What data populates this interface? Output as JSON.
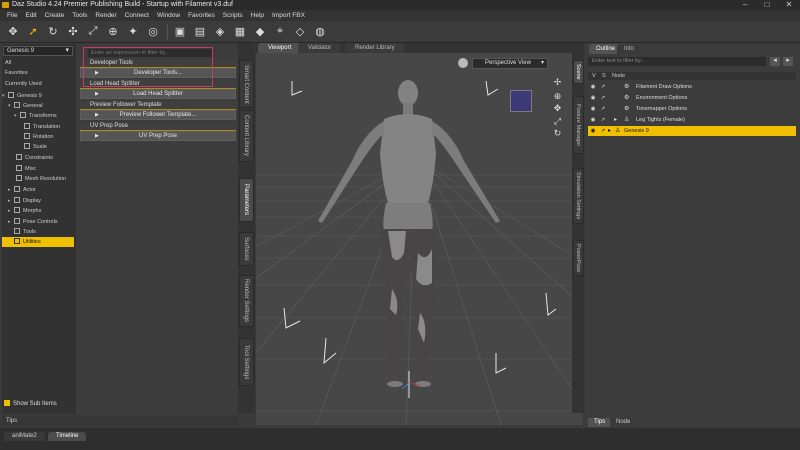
{
  "title": "Daz Studio 4.24 Premier Publishing Build - Startup with Filament v3.duf",
  "menu": [
    "File",
    "Edit",
    "Create",
    "Tools",
    "Render",
    "Connect",
    "Window",
    "Favorites",
    "Scripts",
    "Help",
    "Import FBX"
  ],
  "toolbar_icons": [
    "universal-tool",
    "pointer-tool",
    "rotate-tool",
    "translate-tool",
    "scale-tool",
    "node-tool",
    "pose-tool",
    "camera-tool",
    "render-tool",
    "render-settings-tool",
    "spot-render-tool",
    "preview-tool",
    "morph-tool",
    "joint-tool",
    "geometry-tool",
    "surface-tool"
  ],
  "left": {
    "scope": "Genesis 9",
    "filter_placeholder": "Enter an expression to filter by...",
    "tree": [
      {
        "label": "All",
        "indent": 0
      },
      {
        "label": "Favorites",
        "indent": 0
      },
      {
        "label": "Currently Used",
        "indent": 0
      },
      {
        "label": "Genesis 9",
        "indent": 0
      },
      {
        "label": "General",
        "indent": 1
      },
      {
        "label": "Transforms",
        "indent": 2
      },
      {
        "label": "Translation",
        "indent": 3
      },
      {
        "label": "Rotation",
        "indent": 3
      },
      {
        "label": "Scale",
        "indent": 3
      },
      {
        "label": "Constraints",
        "indent": 2
      },
      {
        "label": "Misc",
        "indent": 2
      },
      {
        "label": "Mesh Resolution",
        "indent": 2
      },
      {
        "label": "Actor",
        "indent": 1
      },
      {
        "label": "Display",
        "indent": 1
      },
      {
        "label": "Morphs",
        "indent": 1
      },
      {
        "label": "Pose Controls",
        "indent": 1
      },
      {
        "label": "Tools",
        "indent": 1
      },
      {
        "label": "Utilities",
        "indent": 1
      }
    ],
    "selected_tree": "Utilities",
    "show_sub_items": "Show Sub Items",
    "groups": [
      {
        "label": "Developer Tools",
        "button": "Developer Tools..."
      },
      {
        "label": "Load Head Splitter",
        "button": "Load Head Splitter"
      },
      {
        "label": "Preview Follower Template",
        "button": "Preview Follower Template..."
      },
      {
        "label": "UV Prep Pose",
        "button": "UV Prep Pose"
      }
    ],
    "vtabs": [
      "Smart Content",
      "Content Library",
      "Parameters",
      "Surfaces",
      "Render Settings",
      "Tool Settings"
    ],
    "active_vtab": "Parameters",
    "tips": "Tips"
  },
  "viewport": {
    "tabs": [
      "Viewport",
      "Validator",
      "Render Library"
    ],
    "active_tab": "Viewport",
    "view": "Perspective View"
  },
  "right": {
    "tabs": [
      "Outline",
      "Info"
    ],
    "active_tab": "Outline",
    "filter_placeholder": "Enter text to filter by...",
    "col_v": "V",
    "col_s": "S",
    "col_node": "Node",
    "nodes": [
      {
        "label": "Filament Draw Options",
        "selected": false
      },
      {
        "label": "Environment Options",
        "selected": false
      },
      {
        "label": "Tonemapper Options",
        "selected": false
      },
      {
        "label": "Leg Tights (Female)",
        "selected": false
      },
      {
        "label": "Genesis 9",
        "selected": true
      }
    ],
    "vtabs": [
      "Scene",
      "Posture Manager",
      "Simulation Settings",
      "PowerPose"
    ],
    "active_vtab": "Scene",
    "bottom_tabs": [
      "Tips",
      "Node"
    ],
    "active_bottom": "Tips"
  },
  "bottom_tabs": [
    "aniMate2",
    "Timeline"
  ],
  "active_bottom_tab": "Timeline",
  "colors": {
    "accent": "#f0c000",
    "highlight": "#d0356f"
  }
}
